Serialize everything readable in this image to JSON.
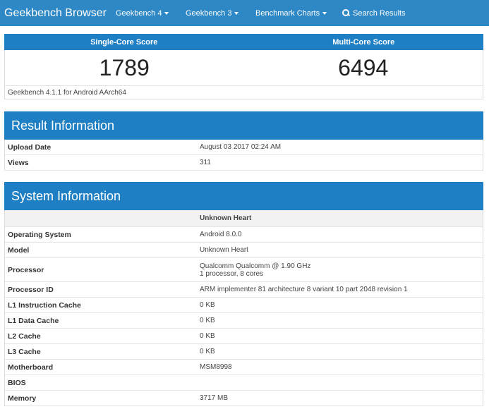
{
  "navbar": {
    "brand": "Geekbench Browser",
    "items": [
      {
        "label": "Geekbench 4",
        "dropdown": true
      },
      {
        "label": "Geekbench 3",
        "dropdown": true
      },
      {
        "label": "Benchmark Charts",
        "dropdown": true
      }
    ],
    "search_label": "Search Results"
  },
  "scores": {
    "single_label": "Single-Core Score",
    "multi_label": "Multi-Core Score",
    "single_value": "1789",
    "multi_value": "6494",
    "version": "Geekbench 4.1.1 for Android AArch64"
  },
  "result_info": {
    "title": "Result Information",
    "rows": [
      {
        "key": "Upload Date",
        "value": "August 03 2017 02:24 AM"
      },
      {
        "key": "Views",
        "value": "311"
      }
    ]
  },
  "system_info": {
    "title": "System Information",
    "device_name": "Unknown Heart",
    "rows": [
      {
        "key": "Operating System",
        "value": "Android 8.0.0"
      },
      {
        "key": "Model",
        "value": "Unknown Heart"
      },
      {
        "key": "Processor",
        "value": "Qualcomm Qualcomm @ 1.90 GHz",
        "value2": "1 processor, 8 cores"
      },
      {
        "key": "Processor ID",
        "value": "ARM implementer 81 architecture 8 variant 10 part 2048 revision 1"
      },
      {
        "key": "L1 Instruction Cache",
        "value": "0 KB"
      },
      {
        "key": "L1 Data Cache",
        "value": "0 KB"
      },
      {
        "key": "L2 Cache",
        "value": "0 KB"
      },
      {
        "key": "L3 Cache",
        "value": "0 KB"
      },
      {
        "key": "Motherboard",
        "value": "MSM8998"
      },
      {
        "key": "BIOS",
        "value": ""
      },
      {
        "key": "Memory",
        "value": "3717 MB"
      }
    ]
  },
  "colors": {
    "navbar": "#2d88c5",
    "section_header": "#1e7fc5"
  }
}
